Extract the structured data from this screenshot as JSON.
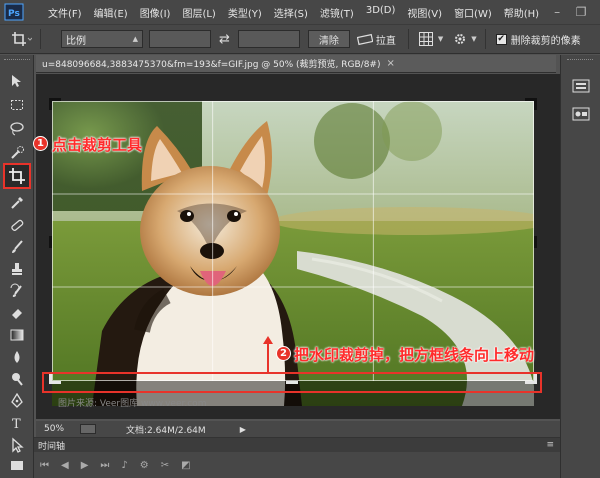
{
  "menu": {
    "items": [
      "文件(F)",
      "编辑(E)",
      "图像(I)",
      "图层(L)",
      "类型(Y)",
      "选择(S)",
      "滤镜(T)",
      "3D(D)",
      "视图(V)",
      "窗口(W)",
      "帮助(H)"
    ]
  },
  "window_controls": {
    "minimize": "–",
    "restore": "❐",
    "close": "✕"
  },
  "options": {
    "ratio_label": "比例",
    "swap_icon": "⇄",
    "clear_label": "清除",
    "straighten_label": "拉直",
    "delete_cropped_label": "删除裁剪的像素",
    "delete_cropped_checked": true
  },
  "document": {
    "tab_title": "u=848096684,3883475370&fm=193&f=GIF.jpg @ 50% (裁剪预览, RGB/8#)",
    "tab_close": "×",
    "watermark": "图片来源: Veer图库 www.veer.com"
  },
  "status": {
    "zoom": "50%",
    "doc_info": "文档:2.64M/2.64M"
  },
  "timeline": {
    "title": "时间轴"
  },
  "annotations": [
    {
      "number": "1",
      "text": "点击裁剪工具"
    },
    {
      "number": "2",
      "text": "把水印裁剪掉，把方框线条向上移动"
    }
  ],
  "colors": {
    "annotation_red": "#e8332a",
    "ps_dark": "#474747",
    "canvas_bg": "#282828"
  }
}
